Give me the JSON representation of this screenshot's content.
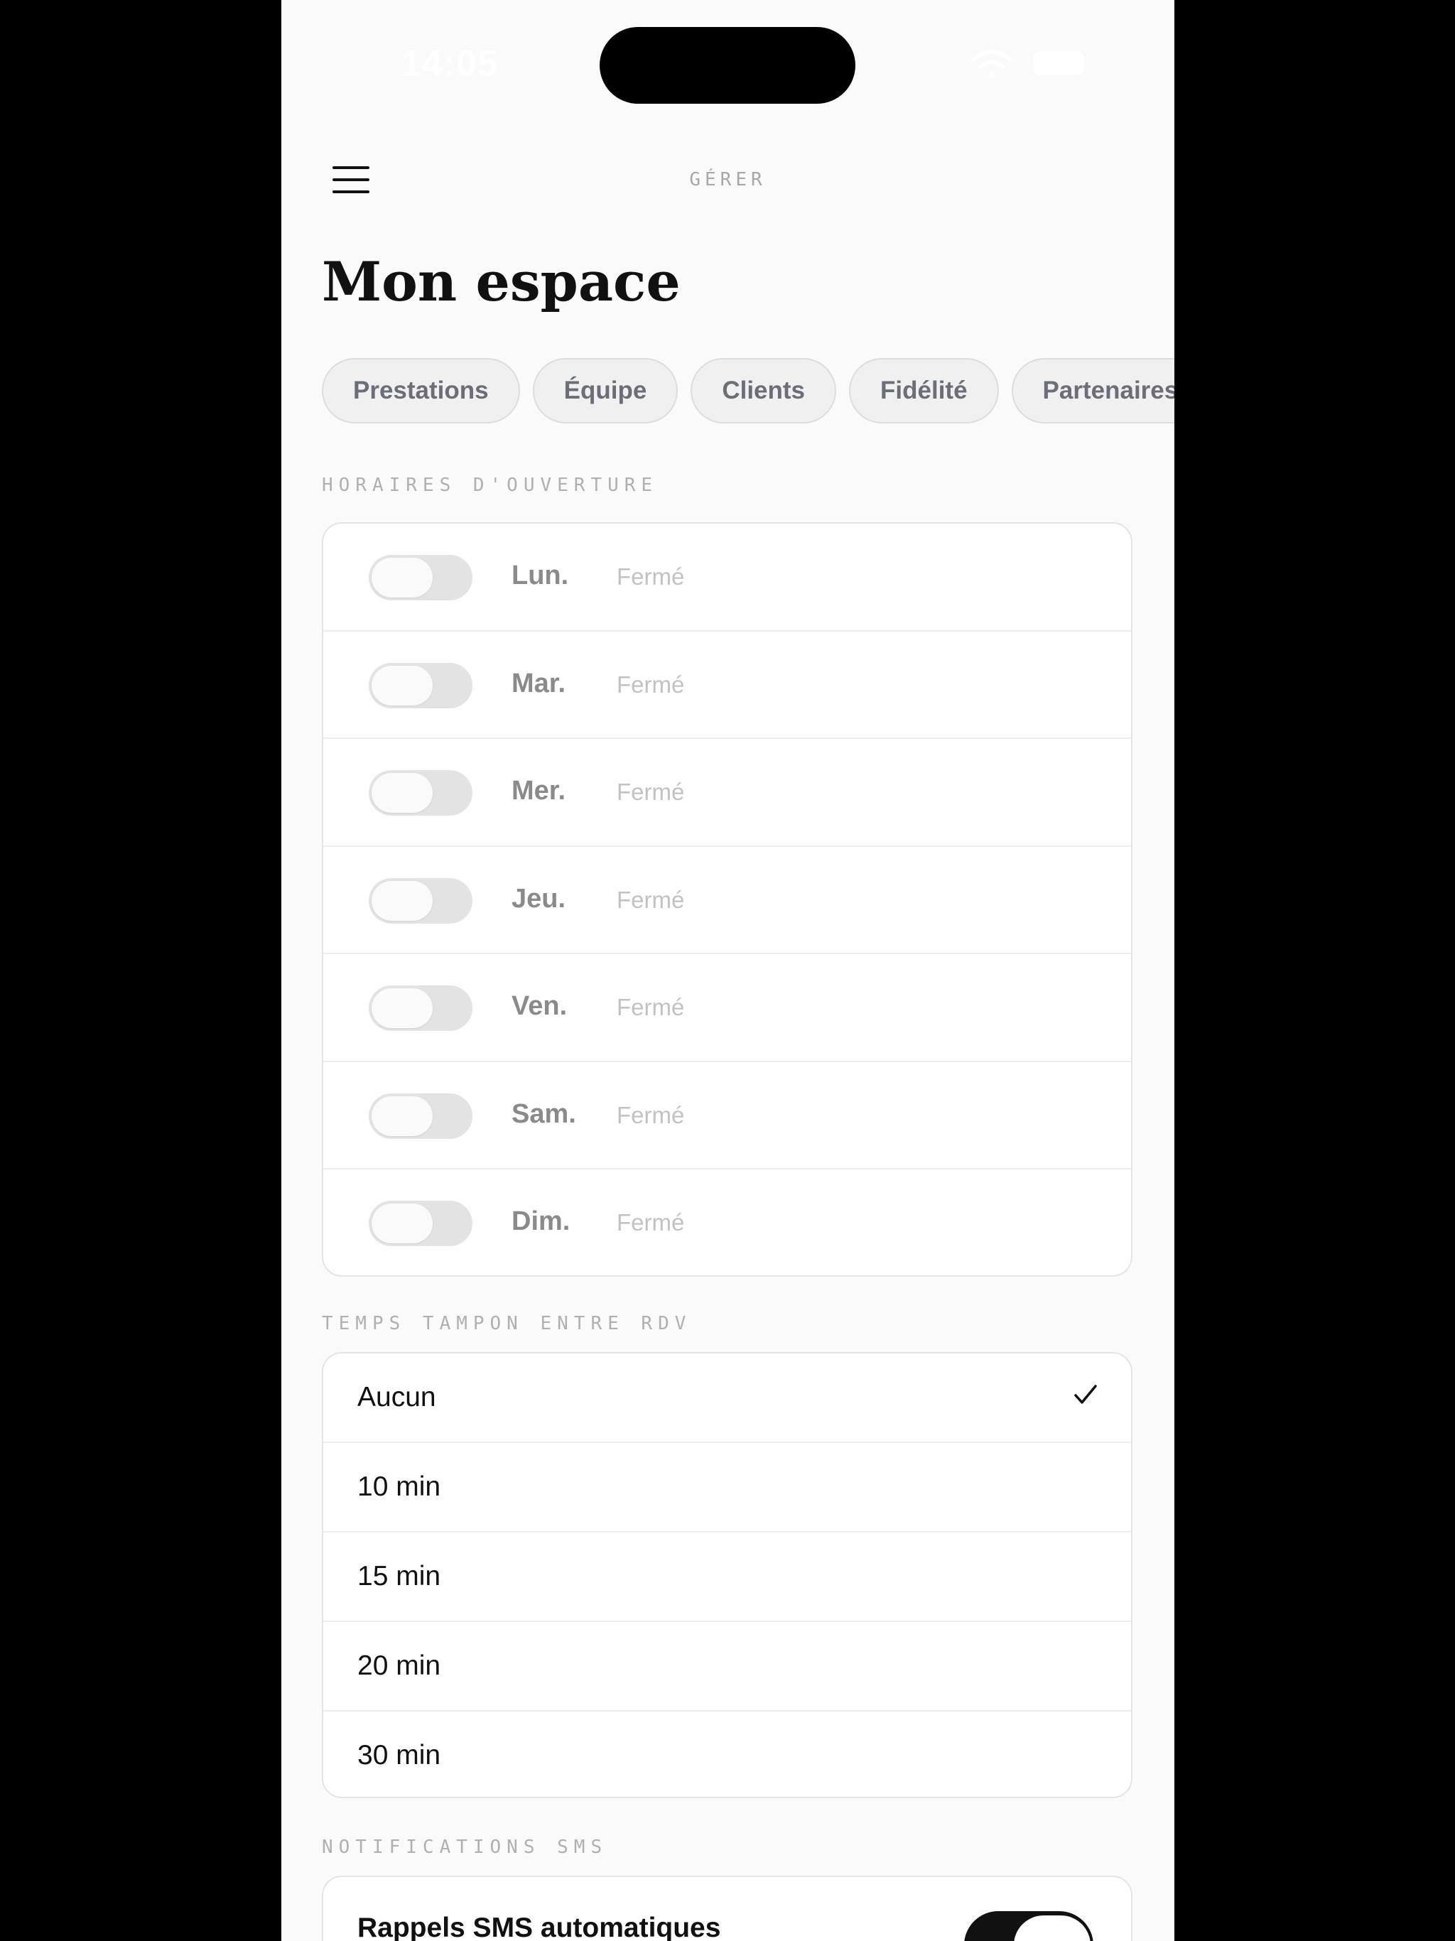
{
  "status_bar": {
    "time": "14:05"
  },
  "header": {
    "title": "GÉRER"
  },
  "page": {
    "title": "Mon espace"
  },
  "tabs": [
    {
      "label": "Prestations"
    },
    {
      "label": "Équipe"
    },
    {
      "label": "Clients"
    },
    {
      "label": "Fidélité"
    },
    {
      "label": "Partenaires"
    }
  ],
  "opening_hours": {
    "section_label": "HORAIRES D'OUVERTURE",
    "days": [
      {
        "day": "Lun.",
        "status": "Fermé",
        "enabled": false
      },
      {
        "day": "Mar.",
        "status": "Fermé",
        "enabled": false
      },
      {
        "day": "Mer.",
        "status": "Fermé",
        "enabled": false
      },
      {
        "day": "Jeu.",
        "status": "Fermé",
        "enabled": false
      },
      {
        "day": "Ven.",
        "status": "Fermé",
        "enabled": false
      },
      {
        "day": "Sam.",
        "status": "Fermé",
        "enabled": false
      },
      {
        "day": "Dim.",
        "status": "Fermé",
        "enabled": false
      }
    ]
  },
  "buffer_time": {
    "section_label": "TEMPS TAMPON ENTRE RDV",
    "options": [
      {
        "label": "Aucun",
        "selected": true
      },
      {
        "label": "10 min",
        "selected": false
      },
      {
        "label": "15 min",
        "selected": false
      },
      {
        "label": "20 min",
        "selected": false
      },
      {
        "label": "30 min",
        "selected": false
      }
    ]
  },
  "sms_notifications": {
    "section_label": "NOTIFICATIONS SMS",
    "auto_reminders_label": "Rappels SMS automatiques",
    "auto_reminders_enabled": true
  },
  "colors": {
    "background": "#fafafa",
    "accent": "#111111",
    "muted_text": "#8a8a8a",
    "closed_text": "#c2c2c2"
  }
}
